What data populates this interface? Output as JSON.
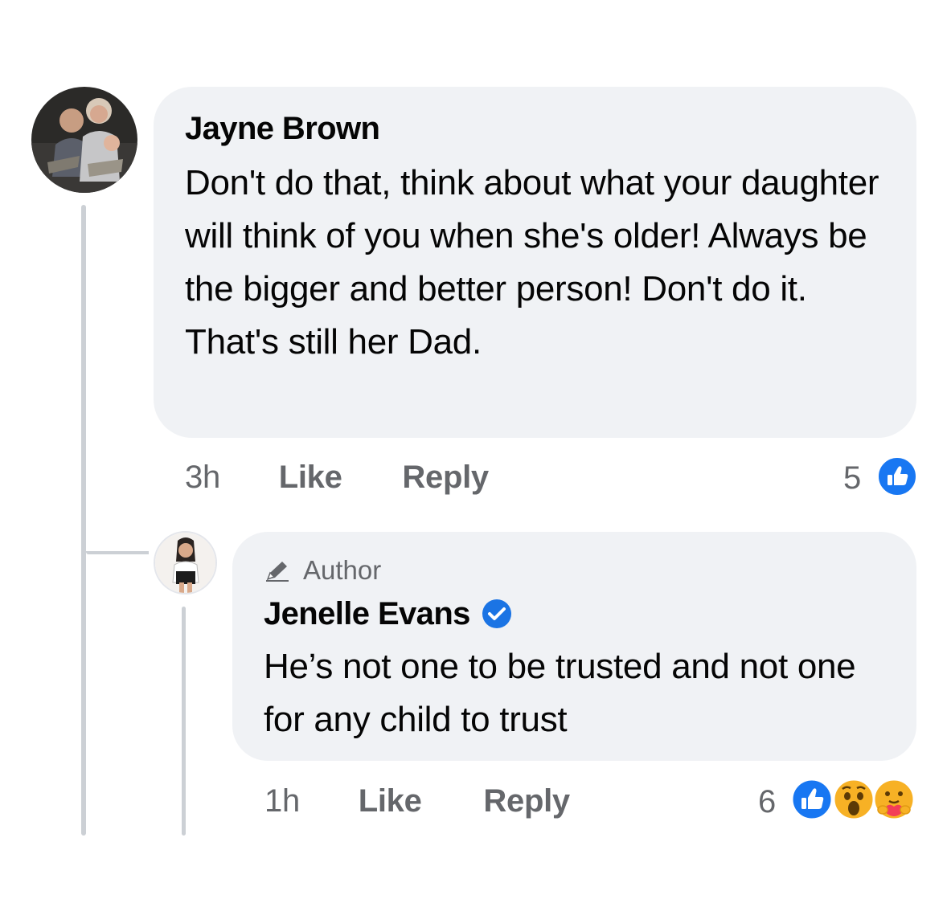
{
  "comment": {
    "author": "Jayne Brown",
    "text": "Don't do that, think about what your daughter will think of you when she's older!  Always be the bigger and better person!  Don't do it.  That's still her Dad.",
    "time": "3h",
    "like_label": "Like",
    "reply_label": "Reply",
    "reaction_count": "5",
    "reaction_icons": [
      "like-icon"
    ]
  },
  "reply": {
    "badge": "Author",
    "author": "Jenelle Evans",
    "verified": true,
    "text": "He’s not one to be trusted and not one for any child to trust",
    "time": "1h",
    "like_label": "Like",
    "reply_label": "Reply",
    "reaction_count": "6",
    "reaction_icons": [
      "like-icon",
      "wow-icon",
      "care-icon"
    ]
  },
  "colors": {
    "bubble": "#f0f2f5",
    "meta_text": "#65676b",
    "like_blue": "#1877f2",
    "verified_blue": "#1b74e4",
    "wow_yellow": "#f7b125",
    "thread_line": "#ccd0d5"
  }
}
